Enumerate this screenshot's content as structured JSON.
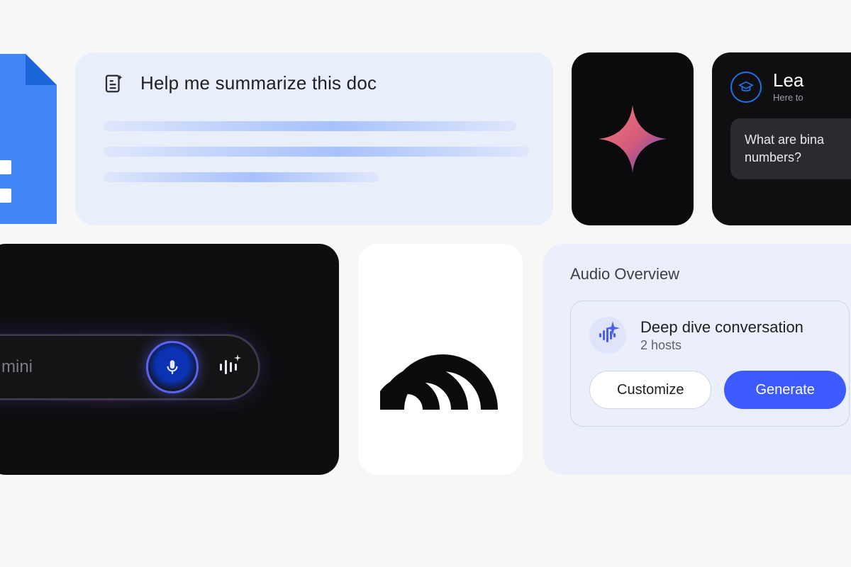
{
  "summarize": {
    "prompt": "Help me summarize this doc",
    "icon": "doc-sparkle-icon"
  },
  "learn": {
    "icon": "graduation-cap-icon",
    "title": "Lea",
    "subtitle": "Here to",
    "question": "What are bina numbers?",
    "question_line1": "What are bina",
    "question_line2": "numbers?"
  },
  "gemini": {
    "placeholder": "mini",
    "mic_icon": "microphone-icon",
    "sparkle_icon": "soundwave-sparkle-icon"
  },
  "audio_overview": {
    "header": "Audio Overview",
    "item": {
      "icon": "soundwave-sparkle-icon",
      "title": "Deep dive conversation",
      "subtitle": "2 hosts"
    },
    "buttons": {
      "customize": "Customize",
      "generate": "Generate"
    }
  },
  "colors": {
    "bg": "#f7f7f5",
    "panel_blue": "#e9eefb",
    "docs_blue": "#4285f4",
    "primary_button": "#3d5afe",
    "dark": "#0e0e10"
  }
}
